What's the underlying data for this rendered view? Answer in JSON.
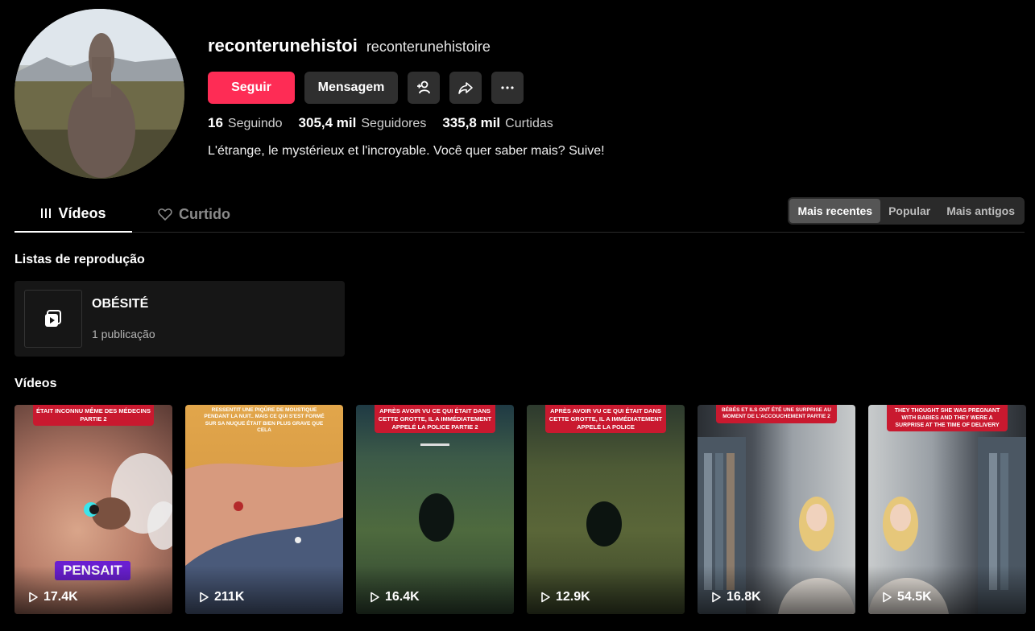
{
  "profile": {
    "username": "reconterunehistoi",
    "nickname": "reconterunehistoire",
    "bio": "L'étrange, le mystérieux et l'incroyable. Você quer saber mais? Suive!"
  },
  "actions": {
    "follow_label": "Seguir",
    "message_label": "Mensagem",
    "add_friend_icon": "add-user-icon",
    "share_icon": "share-icon",
    "more_icon": "more-icon"
  },
  "stats": {
    "following_count": "16",
    "following_label": "Seguindo",
    "followers_count": "305,4 mil",
    "followers_label": "Seguidores",
    "likes_count": "335,8 mil",
    "likes_label": "Curtidas"
  },
  "tabs": {
    "videos": "Vídeos",
    "liked": "Curtido"
  },
  "sort": {
    "recent": "Mais recentes",
    "popular": "Popular",
    "oldest": "Mais antigos",
    "selected": "Mais recentes"
  },
  "playlists": {
    "title": "Listas de reprodução",
    "items": [
      {
        "name": "OBÉSITÉ",
        "count": "1 publicação"
      }
    ]
  },
  "videos": {
    "title": "Vídeos",
    "items": [
      {
        "caption": "était inconnu même des médecins partie 2",
        "views": "17.4K",
        "overlay": "PENSAIT"
      },
      {
        "caption": "ressentit une piqûre de moustique pendant la nuit.. mais ce qui s'est formé sur sa nuque était bien plus grave que cela",
        "views": "211K"
      },
      {
        "caption": "Après avoir vu ce qui était dans cette grotte, il a immédiatement appelé la police partie 2",
        "views": "16.4K"
      },
      {
        "caption": "Après avoir vu ce qui était dans cette grotte, il a immédiatement appelé la police",
        "views": "12.9K"
      },
      {
        "caption": "bébés et ils ont été une surprise au moment de l'accouchement partie 2",
        "views": "16.8K"
      },
      {
        "caption": "They thought she was pregnant with babies and they were a surprise at the time of delivery",
        "views": "54.5K"
      }
    ]
  },
  "colors": {
    "accent": "#fe2c55",
    "background": "#000000",
    "caption_bg": "#c9192f"
  }
}
